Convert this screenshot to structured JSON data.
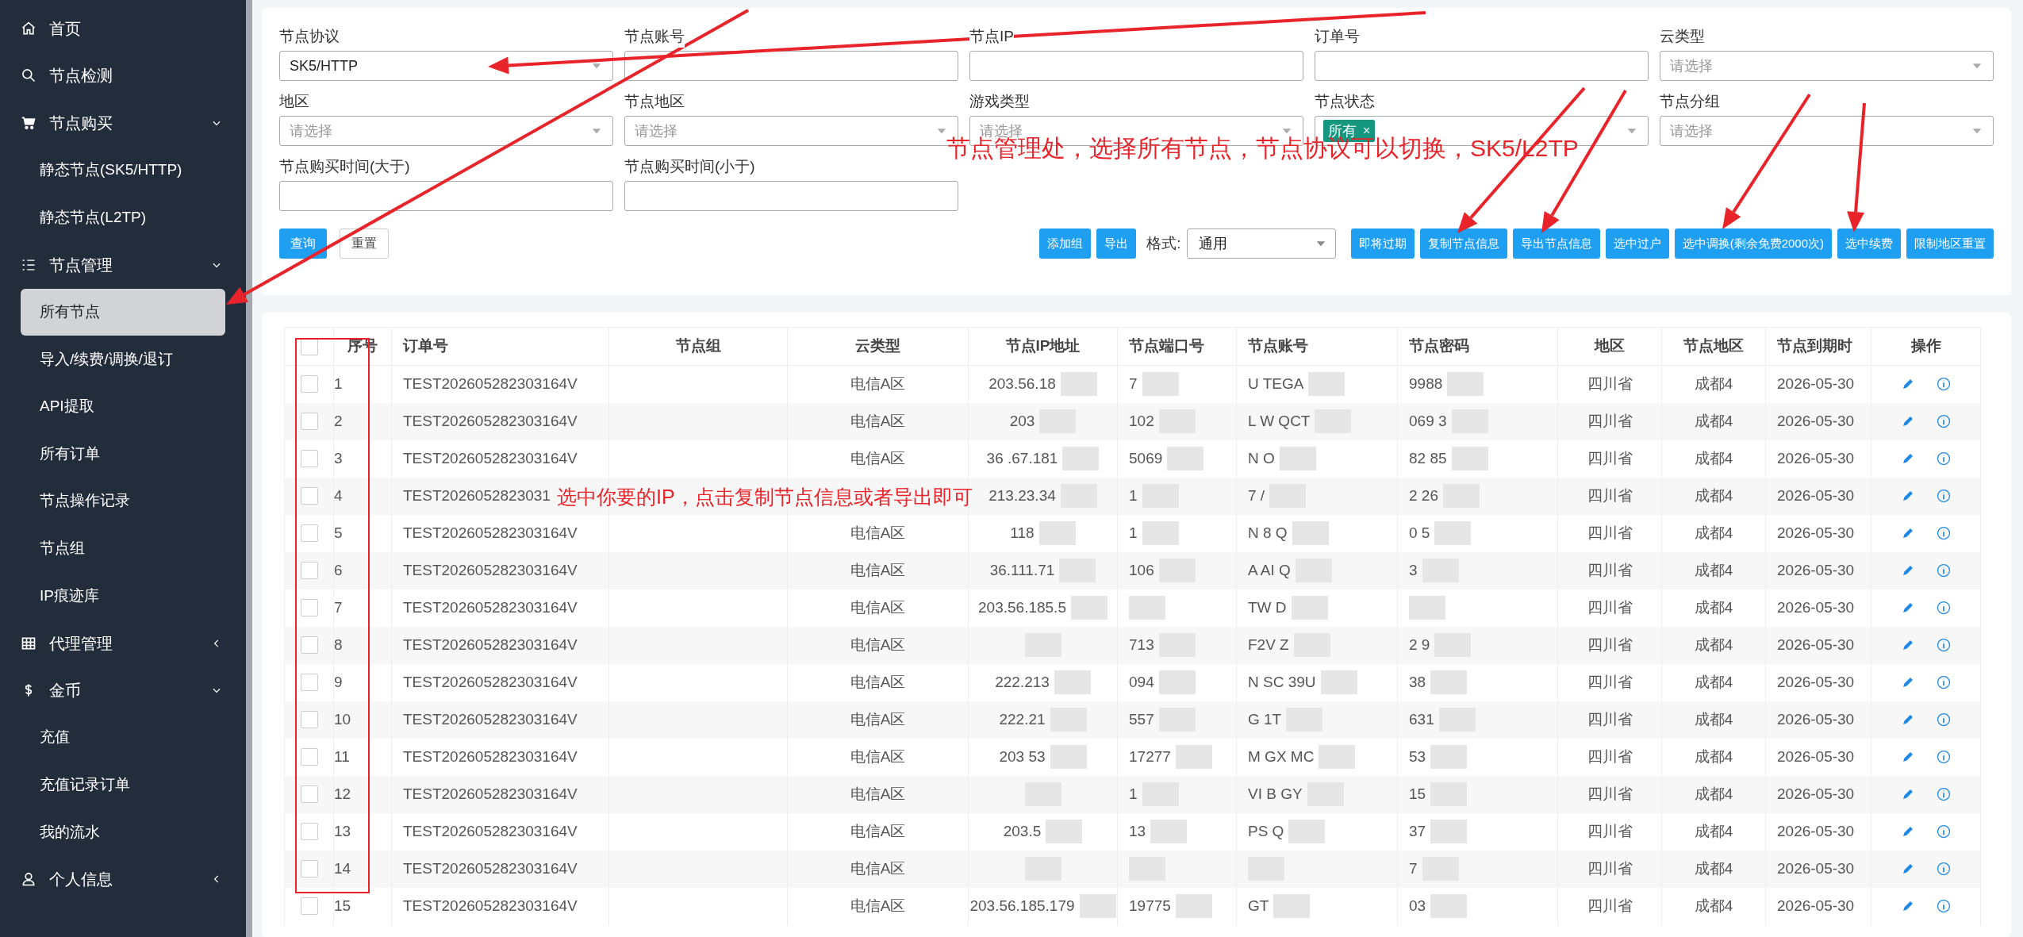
{
  "sidebar": {
    "items": [
      {
        "label": "首页",
        "selected": false
      },
      {
        "label": "节点检测",
        "selected": false
      },
      {
        "label": "节点购买",
        "selected": false,
        "expanded": true,
        "children": [
          {
            "label": "静态节点(SK5/HTTP)",
            "selected": false
          },
          {
            "label": "静态节点(L2TP)",
            "selected": false
          }
        ]
      },
      {
        "label": "节点管理",
        "selected": false,
        "expanded": true,
        "children": [
          {
            "label": "所有节点",
            "selected": true
          },
          {
            "label": "导入/续费/调换/退订",
            "selected": false
          },
          {
            "label": "API提取",
            "selected": false
          },
          {
            "label": "所有订单",
            "selected": false
          },
          {
            "label": "节点操作记录",
            "selected": false
          },
          {
            "label": "节点组",
            "selected": false
          },
          {
            "label": "IP痕迹库",
            "selected": false
          }
        ]
      },
      {
        "label": "代理管理",
        "selected": false,
        "expanded": false
      },
      {
        "label": "金币",
        "selected": false,
        "expanded": true,
        "children": [
          {
            "label": "充值",
            "selected": false
          },
          {
            "label": "充值记录订单",
            "selected": false
          },
          {
            "label": "我的流水",
            "selected": false
          }
        ]
      },
      {
        "label": "个人信息",
        "selected": false,
        "expanded": false
      }
    ]
  },
  "filters": [
    {
      "label": "节点协议",
      "kind": "select",
      "value": "SK5/HTTP"
    },
    {
      "label": "节点账号",
      "kind": "text"
    },
    {
      "label": "节点IP",
      "kind": "text"
    },
    {
      "label": "订单号",
      "kind": "text"
    },
    {
      "label": "云类型",
      "kind": "select",
      "placeholder": "请选择"
    },
    {
      "label": "地区",
      "kind": "select",
      "placeholder": "请选择"
    },
    {
      "label": "节点地区",
      "kind": "select",
      "placeholder": "请选择"
    },
    {
      "label": "游戏类型",
      "kind": "select",
      "placeholder": "请选择"
    },
    {
      "label": "节点状态",
      "kind": "tags",
      "tags": [
        {
          "label": "所有",
          "remove": "×"
        }
      ]
    },
    {
      "label": "节点分组",
      "kind": "select",
      "placeholder": "请选择"
    },
    {
      "label": "节点购买时间(大于)",
      "kind": "text"
    },
    {
      "label": "节点购买时间(小于)",
      "kind": "text"
    }
  ],
  "actions_left": [
    {
      "label": "查询",
      "kind": "primary"
    },
    {
      "label": "重置",
      "kind": "default"
    }
  ],
  "actions_right": [
    {
      "kind": "button",
      "label": "添加组"
    },
    {
      "kind": "button",
      "label": "导出"
    },
    {
      "kind": "format",
      "label": "格式:",
      "value": "通用"
    },
    {
      "kind": "button",
      "label": "即将过期"
    },
    {
      "kind": "button",
      "label": "复制节点信息"
    },
    {
      "kind": "button",
      "label": "导出节点信息"
    },
    {
      "kind": "button",
      "label": "选中过户"
    },
    {
      "kind": "button",
      "label": "选中调换(剩余免费2000次)"
    },
    {
      "kind": "button",
      "label": "选中续费"
    },
    {
      "kind": "button",
      "label": "限制地区重置"
    }
  ],
  "table": {
    "select_all_checked": false,
    "columns": [
      "序号",
      "订单号",
      "节点组",
      "云类型",
      "节点IP地址",
      "节点端口号",
      "节点账号",
      "节点密码",
      "地区",
      "节点地区",
      "节点到期时",
      "操作"
    ],
    "rows": [
      {
        "checked": false,
        "redacted": true,
        "index": "1",
        "order": "TEST202605282303164V",
        "cloud": "电信A区",
        "ip": "203.56.18",
        "port": "7",
        "account": "U TEGA",
        "password": "9988",
        "region": "四川省",
        "node_region": "成都4",
        "expires": "2026-05-30"
      },
      {
        "checked": false,
        "redacted": true,
        "index": "2",
        "order": "TEST202605282303164V",
        "cloud": "电信A区",
        "ip": "203",
        "port": "102",
        "account": "L W QCT",
        "password": "069 3",
        "region": "四川省",
        "node_region": "成都4",
        "expires": "2026-05-30"
      },
      {
        "checked": false,
        "redacted": true,
        "index": "3",
        "order": "TEST202605282303164V",
        "cloud": "电信A区",
        "ip": "36 .67.181",
        "port": "5069",
        "account": "N O",
        "password": "82 85",
        "region": "四川省",
        "node_region": "成都4",
        "expires": "2026-05-30"
      },
      {
        "checked": false,
        "redacted": true,
        "index": "4",
        "order": "TEST2026052823031",
        "ip": "213.23.34",
        "port": "1",
        "account": "7 /",
        "password": "2 26",
        "region": "四川省",
        "node_region": "成都4",
        "expires": "2026-05-30"
      },
      {
        "checked": false,
        "redacted": true,
        "index": "5",
        "order": "TEST202605282303164V",
        "cloud": "电信A区",
        "ip": "118",
        "port": "1",
        "account": "N 8 Q",
        "password": "0 5",
        "region": "四川省",
        "node_region": "成都4",
        "expires": "2026-05-30"
      },
      {
        "checked": false,
        "redacted": true,
        "index": "6",
        "order": "TEST202605282303164V",
        "cloud": "电信A区",
        "ip": "36.111.71",
        "port": "106",
        "account": "A AI Q",
        "password": "3",
        "region": "四川省",
        "node_region": "成都4",
        "expires": "2026-05-30"
      },
      {
        "checked": false,
        "redacted": true,
        "index": "7",
        "order": "TEST202605282303164V",
        "cloud": "电信A区",
        "ip": "203.56.185.5",
        "account": "TW D",
        "region": "四川省",
        "node_region": "成都4",
        "expires": "2026-05-30"
      },
      {
        "checked": false,
        "redacted": true,
        "index": "8",
        "order": "TEST202605282303164V",
        "cloud": "电信A区",
        "port": "713",
        "account": "F2V Z",
        "password": "2 9",
        "region": "四川省",
        "node_region": "成都4",
        "expires": "2026-05-30"
      },
      {
        "checked": false,
        "redacted": true,
        "index": "9",
        "order": "TEST202605282303164V",
        "cloud": "电信A区",
        "ip": "222.213",
        "port": "094",
        "account": "N SC 39U",
        "password": "38",
        "region": "四川省",
        "node_region": "成都4",
        "expires": "2026-05-30"
      },
      {
        "checked": false,
        "redacted": true,
        "index": "10",
        "order": "TEST202605282303164V",
        "cloud": "电信A区",
        "ip": "222.21",
        "port": "557",
        "account": "G 1T",
        "password": "631",
        "region": "四川省",
        "node_region": "成都4",
        "expires": "2026-05-30"
      },
      {
        "checked": false,
        "redacted": true,
        "index": "11",
        "order": "TEST202605282303164V",
        "cloud": "电信A区",
        "ip": "203 53",
        "port": "17277",
        "account": "M GX MC",
        "password": "53",
        "region": "四川省",
        "node_region": "成都4",
        "expires": "2026-05-30"
      },
      {
        "checked": false,
        "redacted": true,
        "index": "12",
        "order": "TEST202605282303164V",
        "cloud": "电信A区",
        "port": "1",
        "account": "VI B GY",
        "password": "15",
        "region": "四川省",
        "node_region": "成都4",
        "expires": "2026-05-30"
      },
      {
        "checked": false,
        "redacted": true,
        "index": "13",
        "order": "TEST202605282303164V",
        "cloud": "电信A区",
        "ip": "203.5",
        "port": "13",
        "account": "PS Q",
        "password": "37",
        "region": "四川省",
        "node_region": "成都4",
        "expires": "2026-05-30"
      },
      {
        "checked": false,
        "redacted": true,
        "index": "14",
        "order": "TEST202605282303164V",
        "cloud": "电信A区",
        "password": "7",
        "region": "四川省",
        "node_region": "成都4",
        "expires": "2026-05-30"
      },
      {
        "checked": false,
        "redacted": true,
        "index": "15",
        "order": "TEST202605282303164V",
        "cloud": "电信A区",
        "ip": "203.56.185.179",
        "port": "19775",
        "account": "GT",
        "password": "03",
        "region": "四川省",
        "node_region": "成都4",
        "expires": "2026-05-30"
      }
    ]
  },
  "annotations": [
    {
      "text": "节点管理处，选择所有节点，节点协议可以切换，SK5/L2TP"
    },
    {
      "text": "选中你要的IP，点击复制节点信息或者导出即可"
    }
  ]
}
